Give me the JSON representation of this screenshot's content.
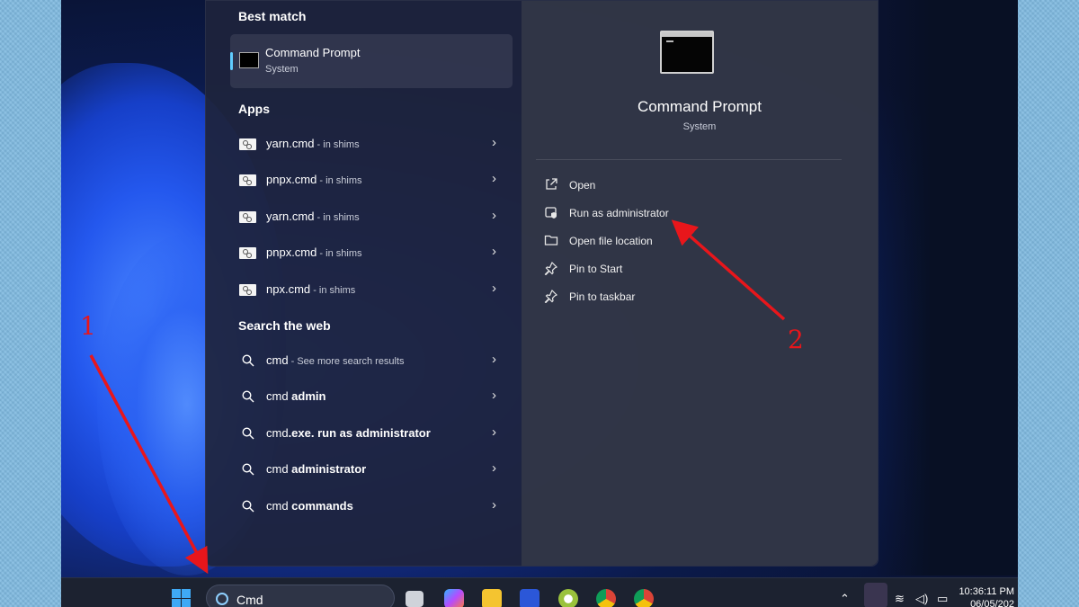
{
  "panel": {
    "best_match": {
      "heading": "Best match",
      "name": "Command Prompt",
      "subtitle": "System"
    },
    "apps": {
      "heading": "Apps",
      "items": [
        {
          "name": "yarn.cmd",
          "suffix": " - in shims"
        },
        {
          "name": "pnpx.cmd",
          "suffix": " - in shims"
        },
        {
          "name": "yarn.cmd",
          "suffix": " - in shims"
        },
        {
          "name": "pnpx.cmd",
          "suffix": " - in shims"
        },
        {
          "name": "npx.cmd",
          "suffix": " - in shims"
        }
      ]
    },
    "web": {
      "heading": "Search the web",
      "items": [
        {
          "plain": "cmd",
          "bold": "",
          "suffix": " - See more search results"
        },
        {
          "plain": "cmd ",
          "bold": "admin",
          "suffix": ""
        },
        {
          "plain": "cmd",
          "bold": ".exe. run as administrator",
          "suffix": ""
        },
        {
          "plain": "cmd ",
          "bold": "administrator",
          "suffix": ""
        },
        {
          "plain": "cmd ",
          "bold": "commands",
          "suffix": ""
        }
      ]
    },
    "detail": {
      "title": "Command Prompt",
      "subtitle": "System",
      "actions": [
        {
          "label": "Open",
          "icon": "open-external-icon"
        },
        {
          "label": "Run as administrator",
          "icon": "shield-run-icon"
        },
        {
          "label": "Open file location",
          "icon": "folder-icon"
        },
        {
          "label": "Pin to Start",
          "icon": "pin-icon"
        },
        {
          "label": "Pin to taskbar",
          "icon": "pin-icon"
        }
      ]
    }
  },
  "taskbar": {
    "search_value": "Cmd",
    "time": "10:36:11 PM",
    "date": "06/05/202"
  },
  "annotations": {
    "label_1": "1",
    "label_2": "2",
    "color": "#e8161b"
  },
  "colors": {
    "accent": "#60cdff",
    "panel_bg": "#1e243c",
    "detail_bg": "#343848"
  }
}
